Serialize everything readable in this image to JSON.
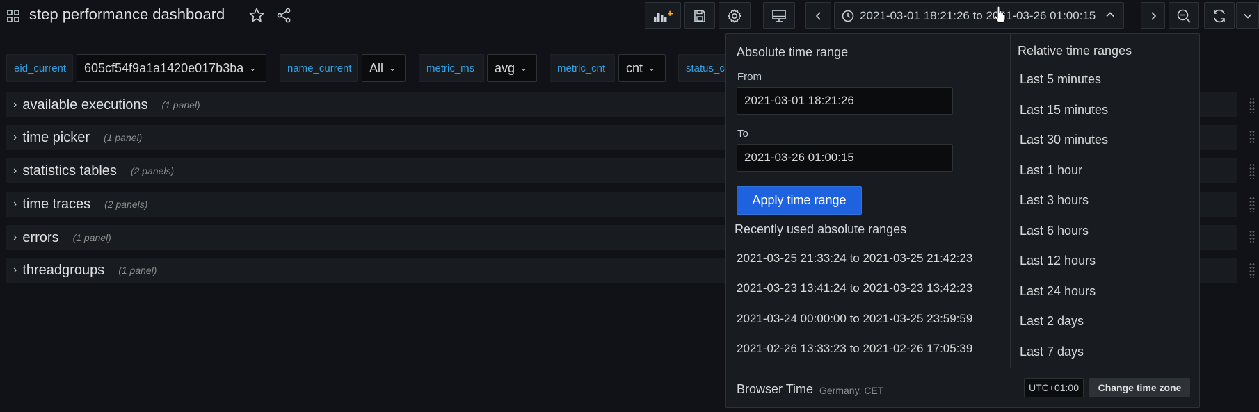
{
  "header": {
    "title": "step performance dashboard",
    "time_range": "2021-03-01 18:21:26 to 2021-03-26 01:00:15"
  },
  "variables": [
    {
      "label": "eid_current",
      "value": "605cf54f9a1a1420e017b3ba"
    },
    {
      "label": "name_current",
      "value": "All"
    },
    {
      "label": "metric_ms",
      "value": "avg"
    },
    {
      "label": "metric_cnt",
      "value": "cnt"
    },
    {
      "label": "status_c",
      "value": ""
    }
  ],
  "rows": [
    {
      "title": "available executions",
      "count": "(1 panel)"
    },
    {
      "title": "time picker",
      "count": "(1 panel)"
    },
    {
      "title": "statistics tables",
      "count": "(2 panels)"
    },
    {
      "title": "time traces",
      "count": "(2 panels)"
    },
    {
      "title": "errors",
      "count": "(1 panel)"
    },
    {
      "title": "threadgroups",
      "count": "(1 panel)"
    }
  ],
  "picker": {
    "absolute_heading": "Absolute time range",
    "from_label": "From",
    "from_value": "2021-03-01 18:21:26",
    "to_label": "To",
    "to_value": "2021-03-26 01:00:15",
    "apply_label": "Apply time range",
    "recent_heading": "Recently used absolute ranges",
    "recent": [
      "2021-03-25 21:33:24 to 2021-03-25 21:42:23",
      "2021-03-23 13:41:24 to 2021-03-23 13:42:23",
      "2021-03-24 00:00:00 to 2021-03-25 23:59:59",
      "2021-02-26 13:33:23 to 2021-02-26 17:05:39"
    ],
    "relative_heading": "Relative time ranges",
    "relative": [
      "Last 5 minutes",
      "Last 15 minutes",
      "Last 30 minutes",
      "Last 1 hour",
      "Last 3 hours",
      "Last 6 hours",
      "Last 12 hours",
      "Last 24 hours",
      "Last 2 days",
      "Last 7 days"
    ],
    "footer": {
      "browser_time": "Browser Time",
      "timezone_name": "Germany, CET",
      "utc_offset": "UTC+01:00",
      "change_tz_label": "Change time zone"
    }
  },
  "colors": {
    "background": "#111217",
    "panel": "#181b1f",
    "accent_blue": "#1f62e0",
    "variable_label": "#33a2e5",
    "add_panel_orange": "#f5a623"
  }
}
